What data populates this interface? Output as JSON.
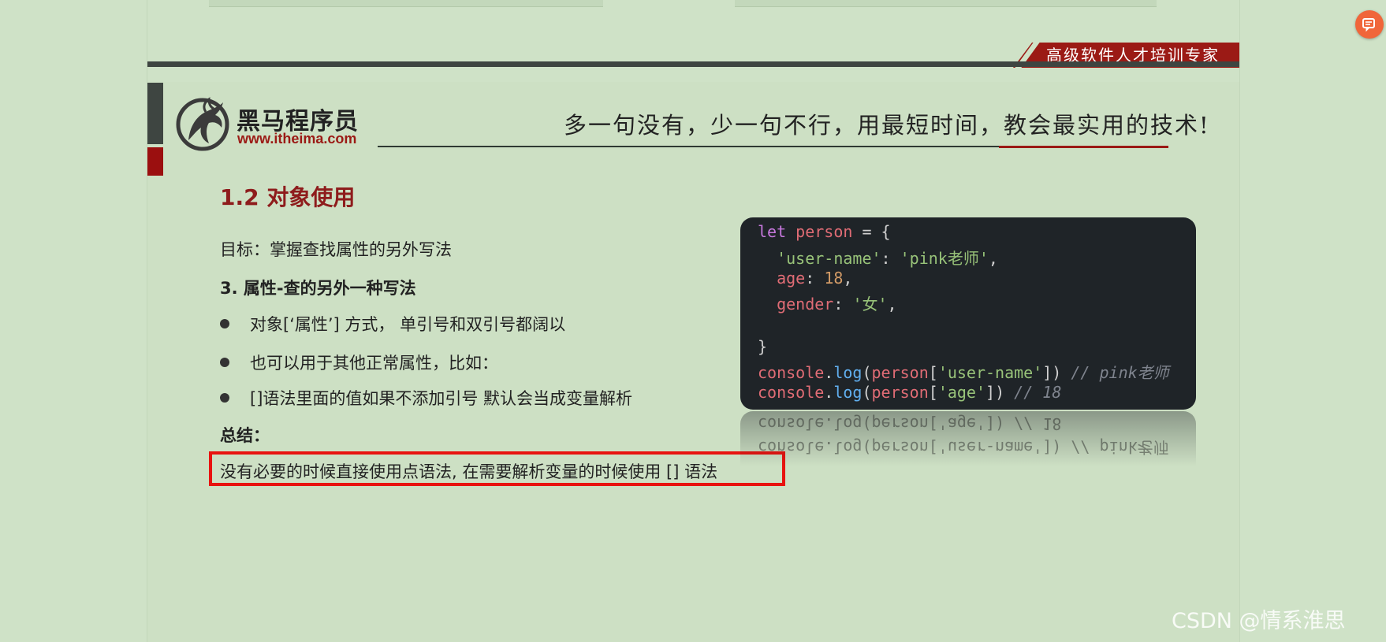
{
  "header": {
    "slogan": "高级软件人才培训专家"
  },
  "brand": {
    "name": "黑马程序员",
    "url": "www.itheima.com",
    "motto": "多一句没有，少一句不行，用最短时间，教会最实用的技术!"
  },
  "slide": {
    "title": "1.2 对象使用",
    "goal": "目标：掌握查找属性的另外写法",
    "point": "3. 属性-查的另外一种写法",
    "bullets": [
      "对象[‘属性’]  方式， 单引号和双引号都阔以",
      "也可以用于其他正常属性，比如：",
      "[]语法里面的值如果不添加引号 默认会当成变量解析"
    ],
    "summary_label": "总结：",
    "summary_text": "没有必要的时候直接使用点语法, 在需要解析变量的时候使用 [] 语法"
  },
  "code": {
    "let": "let",
    "person": "person",
    "open": " = {",
    "key1": "'user-name'",
    "val1": "'pink老师'",
    "key2": "age",
    "val2": "18",
    "key3": "gender",
    "val3": "'女'",
    "close": "}",
    "console": "console",
    "log": "log",
    "arg1": "'user-name'",
    "comment1": "// pink老师",
    "arg2": "'age'",
    "comment2": "// 18"
  },
  "watermark": "CSDN @情系淮思",
  "colors": {
    "background": "#cfe2c7",
    "brand_red": "#9b1a15",
    "highlight": "#e8130f",
    "code_bg": "#1f2428"
  }
}
